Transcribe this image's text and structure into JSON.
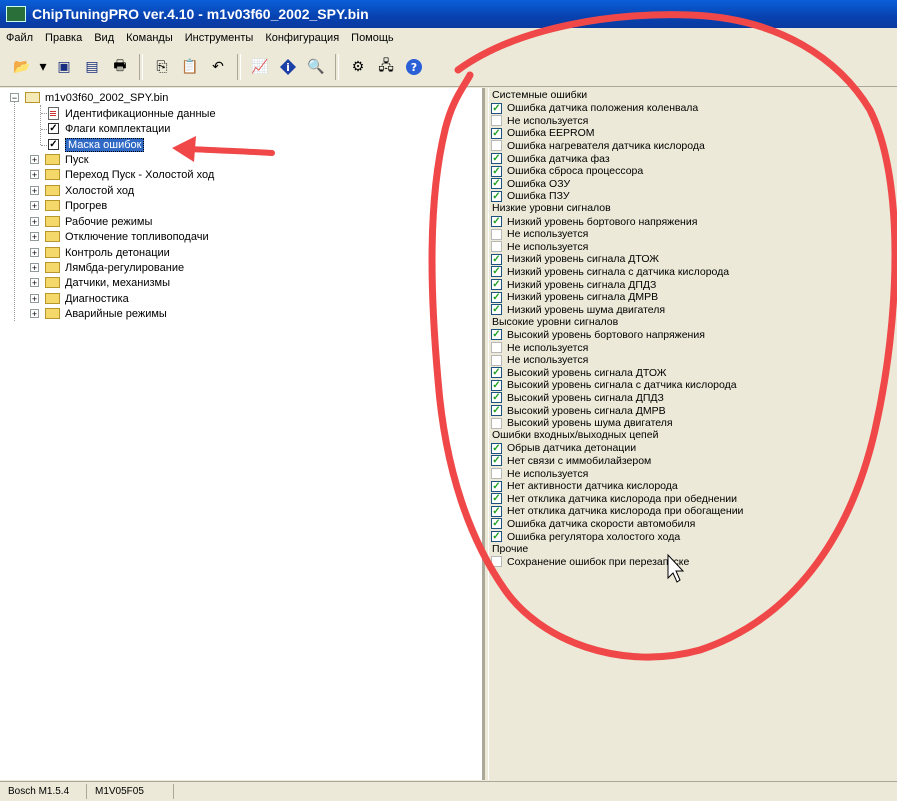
{
  "window": {
    "title": "ChipTuningPRO ver.4.10 - m1v03f60_2002_SPY.bin"
  },
  "menu": [
    "Файл",
    "Правка",
    "Вид",
    "Команды",
    "Инструменты",
    "Конфигурация",
    "Помощь"
  ],
  "toolbar": {
    "icons": [
      "open-icon",
      "dropdown-icon",
      "save-icon",
      "save-as-icon",
      "print-icon",
      "copy-icon",
      "paste-icon",
      "undo-icon",
      "chart-icon",
      "info-icon",
      "search-icon",
      "tools-icon",
      "network-icon",
      "help-icon"
    ]
  },
  "tree": {
    "root": "m1v03f60_2002_SPY.bin",
    "children": [
      "Идентификационные данные",
      "Флаги комплектации",
      "Маска ошибок"
    ],
    "folders": [
      "Пуск",
      "Переход Пуск - Холостой ход",
      "Холостой ход",
      "Прогрев",
      "Рабочие режимы",
      "Отключение топливоподачи",
      "Контроль детонации",
      "Лямбда-регулирование",
      "Датчики, механизмы",
      "Диагностика",
      "Аварийные режимы"
    ]
  },
  "errors": {
    "groups": [
      {
        "title": "Системные ошибки",
        "items": [
          {
            "label": "Ошибка датчика положения коленвала",
            "checked": true
          },
          {
            "label": "Не используется",
            "checked": false
          },
          {
            "label": "Ошибка EEPROM",
            "checked": true
          },
          {
            "label": "Ошибка нагревателя датчика кислорода",
            "checked": false
          },
          {
            "label": "Ошибка датчика фаз",
            "checked": true
          },
          {
            "label": "Ошибка сброса процессора",
            "checked": true
          },
          {
            "label": "Ошибка ОЗУ",
            "checked": true
          },
          {
            "label": "Ошибка ПЗУ",
            "checked": true
          }
        ]
      },
      {
        "title": "Низкие уровни сигналов",
        "items": [
          {
            "label": "Низкий уровень бортового напряжения",
            "checked": true
          },
          {
            "label": "Не используется",
            "checked": false
          },
          {
            "label": "Не используется",
            "checked": false
          },
          {
            "label": "Низкий уровень сигнала ДТОЖ",
            "checked": true
          },
          {
            "label": "Низкий уровень сигнала с датчика кислорода",
            "checked": true
          },
          {
            "label": "Низкий уровень сигнала ДПДЗ",
            "checked": true
          },
          {
            "label": "Низкий уровень сигнала ДМРВ",
            "checked": true
          },
          {
            "label": "Низкий уровень шума двигателя",
            "checked": true
          }
        ]
      },
      {
        "title": "Высокие уровни сигналов",
        "items": [
          {
            "label": "Высокий уровень бортового напряжения",
            "checked": true
          },
          {
            "label": "Не используется",
            "checked": false
          },
          {
            "label": "Не используется",
            "checked": false
          },
          {
            "label": "Высокий уровень сигнала ДТОЖ",
            "checked": true
          },
          {
            "label": "Высокий уровень сигнала с датчика кислорода",
            "checked": true
          },
          {
            "label": "Высокий уровень сигнала ДПДЗ",
            "checked": true
          },
          {
            "label": "Высокий уровень сигнала ДМРВ",
            "checked": true
          },
          {
            "label": "Высокий уровень шума двигателя",
            "checked": false
          }
        ]
      },
      {
        "title": "Ошибки входных/выходных цепей",
        "items": [
          {
            "label": "Обрыв датчика детонации",
            "checked": true
          },
          {
            "label": "Нет связи с иммобилайзером",
            "checked": true
          },
          {
            "label": "Не используется",
            "checked": false
          },
          {
            "label": "Нет активности датчика кислорода",
            "checked": true
          },
          {
            "label": "Нет отклика датчика кислорода при обеднении",
            "checked": true
          },
          {
            "label": "Нет отклика датчика кислорода при обогащении",
            "checked": true
          },
          {
            "label": "Ошибка датчика скорости автомобиля",
            "checked": true
          },
          {
            "label": "Ошибка регулятора холостого хода",
            "checked": true
          }
        ]
      },
      {
        "title": "Прочие",
        "items": [
          {
            "label": "Сохранение ошибок при перезапуске",
            "checked": false
          }
        ]
      }
    ]
  },
  "status": {
    "ecu": "Bosch M1.5.4",
    "firmware": "M1V05F05"
  },
  "annotation": {
    "color": "#f04848"
  }
}
